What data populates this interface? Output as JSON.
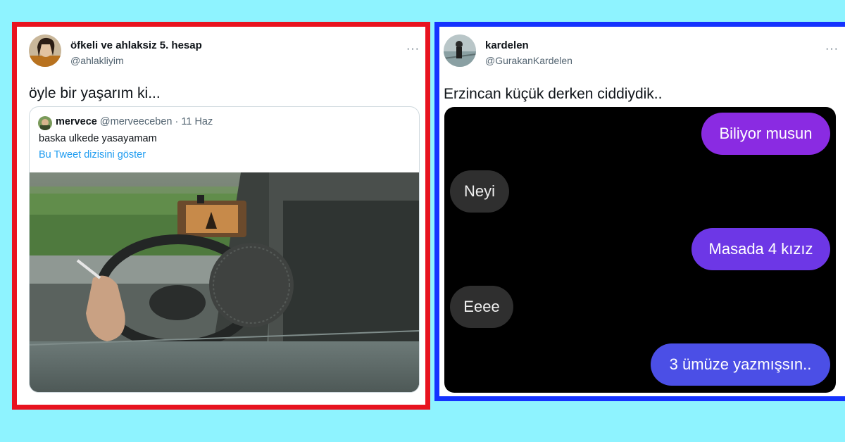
{
  "left_tweet": {
    "display_name": "öfkeli ve ahlaksiz 5. hesap",
    "handle": "@ahlakliyim",
    "more_label": "···",
    "text": "öyle bir yaşarım ki...",
    "quote": {
      "name": "mervece",
      "handle": "@merveeceben",
      "separator": " · ",
      "date": "11 Haz",
      "text": "baska ulkede yasayamam",
      "thread_link": "Bu Tweet dizisini göster"
    }
  },
  "right_tweet": {
    "display_name": "kardelen",
    "handle": "@GurakanKardelen",
    "more_label": "···",
    "text": "Erzincan küçük derken ciddiydik..",
    "chat": [
      {
        "side": "out",
        "text": "Biliyor musun"
      },
      {
        "side": "in",
        "text": "Neyi"
      },
      {
        "side": "out",
        "text": "Masada 4 kızız"
      },
      {
        "side": "in",
        "text": "Eeee"
      },
      {
        "side": "out",
        "text": "3 ümüze yazmışsın.."
      }
    ]
  },
  "colors": {
    "background": "#8ef3ff",
    "left_frame": "#e8131f",
    "right_frame": "#1433ff",
    "link": "#1d9bf0",
    "outgoing_bubble_top": "#8a2be2",
    "outgoing_bubble_bottom": "#4b4fe6",
    "incoming_bubble": "#2f2f2f"
  }
}
